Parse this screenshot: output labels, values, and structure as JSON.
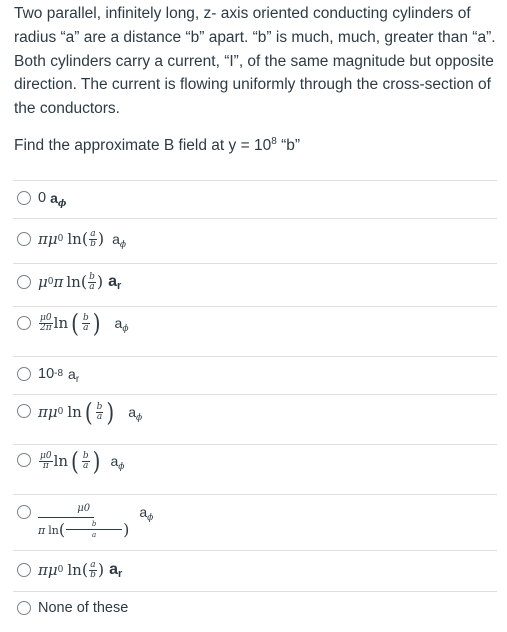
{
  "question": {
    "paragraph": "Two parallel, infinitely long, z- axis oriented conducting cylinders of radius “a” are a distance “b” apart. “b” is much, much, greater than “a”. Both cylinders carry a current, “I”, of the same magnitude but opposite direction. The current is flowing uniformly through the cross-section of the conductors.",
    "prompt_before": "Find the approximate B field at y = 10",
    "prompt_exponent": "8",
    "prompt_after": " “b”"
  },
  "options": [
    {
      "id": "opt1",
      "label": "0 aϕ",
      "lead": "0",
      "unit": "a",
      "unit_sub": "ϕ"
    },
    {
      "id": "opt2",
      "label": "πμ0 ln(a/b) aϕ",
      "pi": "π",
      "mu": "μ",
      "mu_sub": "0",
      "ln": "ln",
      "num": "a",
      "den": "b",
      "unit": "a",
      "unit_sub": "ϕ"
    },
    {
      "id": "opt3",
      "label": "μ0π ln(b/a) ar",
      "pi": "π",
      "mu": "μ",
      "mu_sub": "0",
      "ln": "ln",
      "num": "b",
      "den": "a",
      "unit": "a",
      "unit_sub": "r"
    },
    {
      "id": "opt4",
      "label": "μ0/2π ln(b/a) aϕ",
      "coef_num": "μ0",
      "coef_den": "2π",
      "ln": "ln",
      "num": "b",
      "den": "a",
      "unit": "a",
      "unit_sub": "ϕ"
    },
    {
      "id": "opt5",
      "label": "10^-8 ar",
      "base": "10",
      "exp": "-8",
      "unit": "a",
      "unit_sub": "r"
    },
    {
      "id": "opt6",
      "label": "πμ0 ln(b/a) aϕ",
      "pi": "π",
      "mu": "μ",
      "mu_sub": "0",
      "ln": "ln",
      "num": "b",
      "den": "a",
      "unit": "a",
      "unit_sub": "ϕ"
    },
    {
      "id": "opt7",
      "label": "μ0/π ln(b/a) aϕ",
      "coef_num": "μ0",
      "coef_den": "π",
      "ln": "ln",
      "num": "b",
      "den": "a",
      "unit": "a",
      "unit_sub": "ϕ"
    },
    {
      "id": "opt8",
      "label": "μ0 / (π ln(b/a)) aϕ",
      "top": "μ0",
      "pi": "π",
      "ln": "ln",
      "num": "b",
      "den": "a",
      "unit": "a",
      "unit_sub": "ϕ"
    },
    {
      "id": "opt9",
      "label": "πμ0 ln(a/b) ar",
      "pi": "π",
      "mu": "μ",
      "mu_sub": "0",
      "ln": "ln",
      "num": "a",
      "den": "b",
      "unit": "a",
      "unit_sub": "r"
    },
    {
      "id": "opt10",
      "label": "None of these",
      "text": "None of these"
    }
  ],
  "symbols": {
    "lparen": "(",
    "rparen": ")"
  },
  "colors": {
    "text": "#2d3b45",
    "divider": "#dcdfe2",
    "radio_border": "#7b8287"
  }
}
